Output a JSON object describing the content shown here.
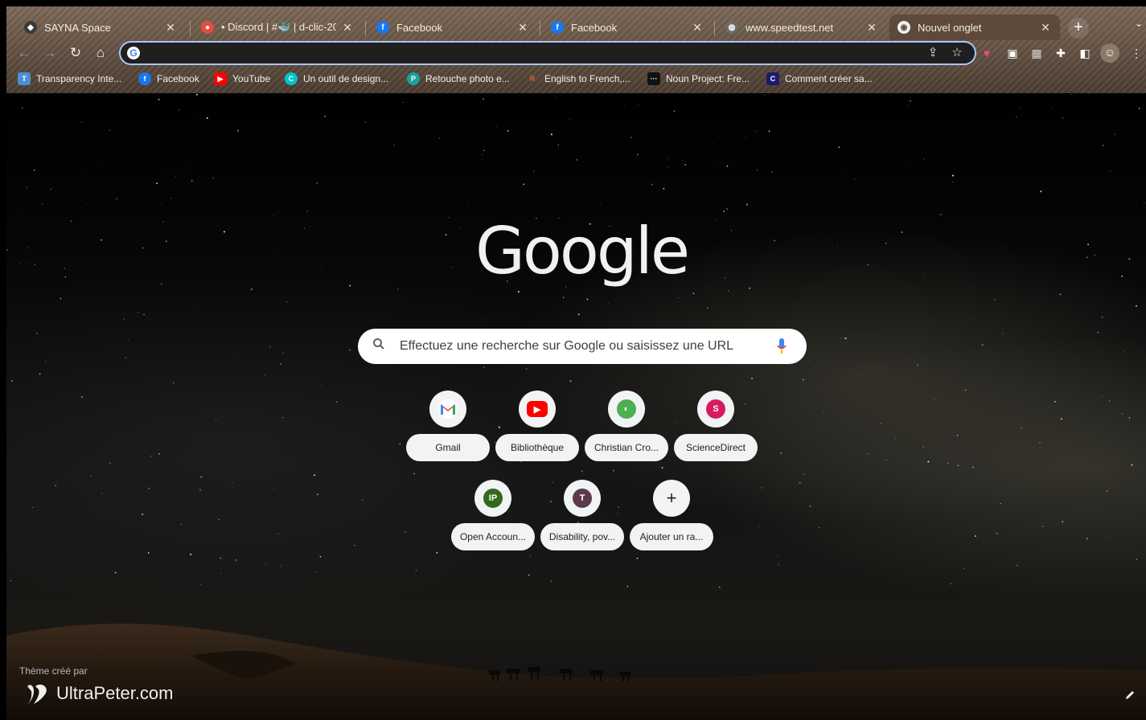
{
  "tabs": [
    {
      "title": "SAYNA Space",
      "icon": "sayna-icon",
      "color": "#2b2b2b"
    },
    {
      "title": "• Discord | #🐳 | d-clic-20",
      "icon": "discord-icon",
      "color": "#e74c3c"
    },
    {
      "title": "Facebook",
      "icon": "facebook-icon",
      "color": "#1877f2"
    },
    {
      "title": "Facebook",
      "icon": "facebook-icon",
      "color": "#1877f2"
    },
    {
      "title": "www.speedtest.net",
      "icon": "globe-icon",
      "color": "#6b6b6b"
    },
    {
      "title": "Nouvel onglet",
      "icon": "chrome-icon",
      "color": "#5c4a3c",
      "active": true
    }
  ],
  "toolbar": {
    "omnibox_value": ""
  },
  "bookmarks": [
    {
      "label": "Transparency Inte...",
      "icon": "transparency-icon",
      "color": "#4a90d9"
    },
    {
      "label": "Facebook",
      "icon": "facebook-icon",
      "color": "#1877f2"
    },
    {
      "label": "YouTube",
      "icon": "youtube-icon",
      "color": "#ff0000"
    },
    {
      "label": "Un outil de design...",
      "icon": "canva-icon",
      "color": "#00c4cc"
    },
    {
      "label": "Retouche photo e...",
      "icon": "photopea-icon",
      "color": "#18a497"
    },
    {
      "label": "English to French,...",
      "icon": "reverso-icon",
      "color": "#c0392b"
    },
    {
      "label": "Noun Project: Fre...",
      "icon": "noun-project-icon",
      "color": "#111111"
    },
    {
      "label": "Comment créer sa...",
      "icon": "bookmark-c-icon",
      "color": "#1a1a6e"
    }
  ],
  "ntp": {
    "logo_text": "Google",
    "search_placeholder": "Effectuez une recherche sur Google ou saisissez une URL",
    "shortcuts_row1": [
      {
        "label": "Gmail",
        "icon": "gmail-icon",
        "letter": "M",
        "color": "#ffffff"
      },
      {
        "label": "Bibliothèque",
        "icon": "youtube-icon",
        "letter": "▶",
        "color": "#ff0000"
      },
      {
        "label": "Christian Cro...",
        "icon": "site-icon",
        "letter": "e",
        "color": "#4caf50"
      },
      {
        "label": "ScienceDirect",
        "icon": "letter-s-icon",
        "letter": "S",
        "color": "#d81b60"
      }
    ],
    "shortcuts_row2": [
      {
        "label": "Open Accoun...",
        "icon": "letter-ip-icon",
        "letter": "IP",
        "color": "#33691e"
      },
      {
        "label": "Disability, pov...",
        "icon": "letter-t-icon",
        "letter": "T",
        "color": "#5d3a4a"
      },
      {
        "label": "Ajouter un ra...",
        "icon": "plus-icon",
        "letter": "+",
        "color": "#f1f3f4"
      }
    ],
    "theme_credit": "Thème créé par",
    "theme_brand": "UltraPeter.com"
  }
}
